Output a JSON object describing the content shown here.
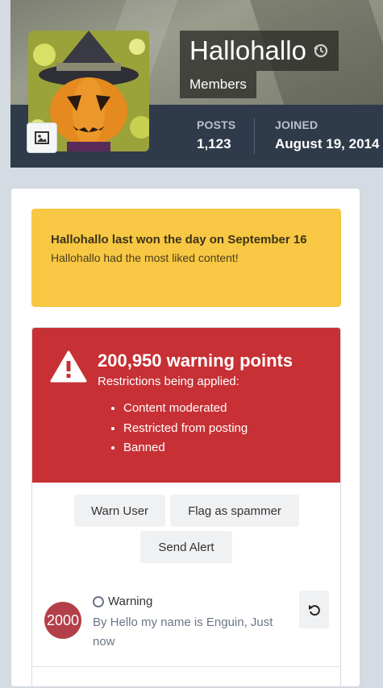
{
  "profile": {
    "username": "Hallohallo",
    "group": "Members",
    "stats": [
      {
        "label": "POSTS",
        "value": "1,123"
      },
      {
        "label": "JOINED",
        "value": "August 19, 2014"
      }
    ],
    "icons": {
      "history": "history-icon",
      "cover_photo": "image-icon"
    }
  },
  "day_winner": {
    "title": "Hallohallo last won the day on September 16",
    "subtitle": "Hallohallo had the most liked content!"
  },
  "warnings": {
    "points": "200,950 warning points",
    "restrictions_label": "Restrictions being applied:",
    "restrictions": [
      "Content moderated",
      "Restricted from posting",
      "Banned"
    ],
    "buttons": {
      "warn_user": "Warn User",
      "flag_spammer": "Flag as spammer",
      "send_alert": "Send Alert"
    },
    "entry": {
      "badge": "2000",
      "title": "Warning",
      "by": "By Hello my name is Enguin, Just now"
    }
  },
  "colors": {
    "stats_bar": "#2f3a4a",
    "day_box": "#f8c743",
    "warning_red": "#c73034",
    "badge": "#b34048"
  }
}
